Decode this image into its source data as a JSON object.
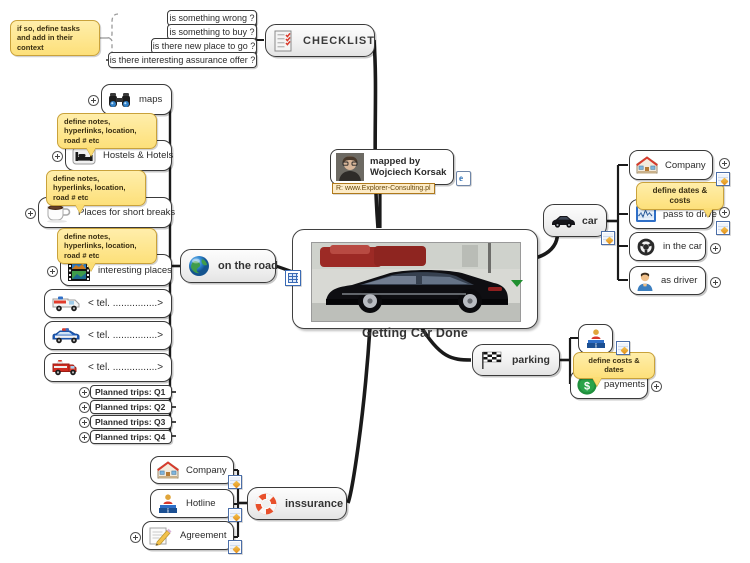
{
  "app": {
    "title": "Getting Car Done"
  },
  "center": {
    "title": "Getting Car Done",
    "image_alt": "black sedan car photo"
  },
  "attribution": {
    "line1": "mapped by",
    "line2": "Wojciech Korsak",
    "hyperlink": "R: www.Explorer-Consulting.pl"
  },
  "checklist": {
    "title": "CHECKLIST",
    "note": "if so, define tasks and add in their context",
    "items": [
      {
        "label": "is something wrong ?"
      },
      {
        "label": "is something to buy ?"
      },
      {
        "label": "is there new place to go ?"
      },
      {
        "label": "is there interesting assurance offer ?"
      }
    ]
  },
  "on_the_road": {
    "title": "on the road",
    "icon": "globe-icon",
    "note_text": "define notes, hyperlinks, location, road # etc",
    "children": [
      {
        "label": "maps",
        "icon": "binoculars-icon"
      },
      {
        "label": "Hostels & Hotels",
        "icon": "bed-icon"
      },
      {
        "label": "Places for short breaks",
        "icon": "coffee-cup-icon"
      },
      {
        "label": "interesting places",
        "icon": "film-strip-icon"
      },
      {
        "label": "< tel. ................>",
        "icon": "ambulance-icon"
      },
      {
        "label": "< tel. ................>",
        "icon": "police-car-icon"
      },
      {
        "label": "< tel. ................>",
        "icon": "fire-truck-icon"
      }
    ],
    "planned_trips": [
      {
        "label": "Planned trips: Q1"
      },
      {
        "label": "Planned trips: Q2"
      },
      {
        "label": "Planned trips: Q3"
      },
      {
        "label": "Planned trips: Q4"
      }
    ]
  },
  "car": {
    "title": "car",
    "icon": "car-icon",
    "note_text": "define dates & costs",
    "children": [
      {
        "label": "Company",
        "icon": "house-icon"
      },
      {
        "label": "pass to drive",
        "icon": "chart-monitor-icon"
      },
      {
        "label": "in the car",
        "icon": "steering-wheel-icon"
      },
      {
        "label": "as driver",
        "icon": "person-icon"
      }
    ]
  },
  "parking": {
    "title": "parking",
    "icon": "checkered-flag-icon",
    "note_text": "define costs & dates",
    "children": [
      {
        "label": "",
        "icon": "info-desk-icon"
      },
      {
        "label": "payments",
        "icon": "dollar-coin-icon"
      }
    ]
  },
  "insurance": {
    "title": "inssurance",
    "icon": "lifebuoy-icon",
    "children": [
      {
        "label": "Company",
        "icon": "house-icon"
      },
      {
        "label": "Hotline",
        "icon": "info-desk-icon"
      },
      {
        "label": "Agreement",
        "icon": "pencil-document-icon"
      }
    ]
  },
  "colors": {
    "callout_fill": "#fde07a",
    "callout_border": "#c9a23b",
    "node_border": "#3a3a3a",
    "link_line": "#1a1a1a",
    "caret_green": "#1f8f2f",
    "hyperlink_fill": "#fdecc8"
  }
}
